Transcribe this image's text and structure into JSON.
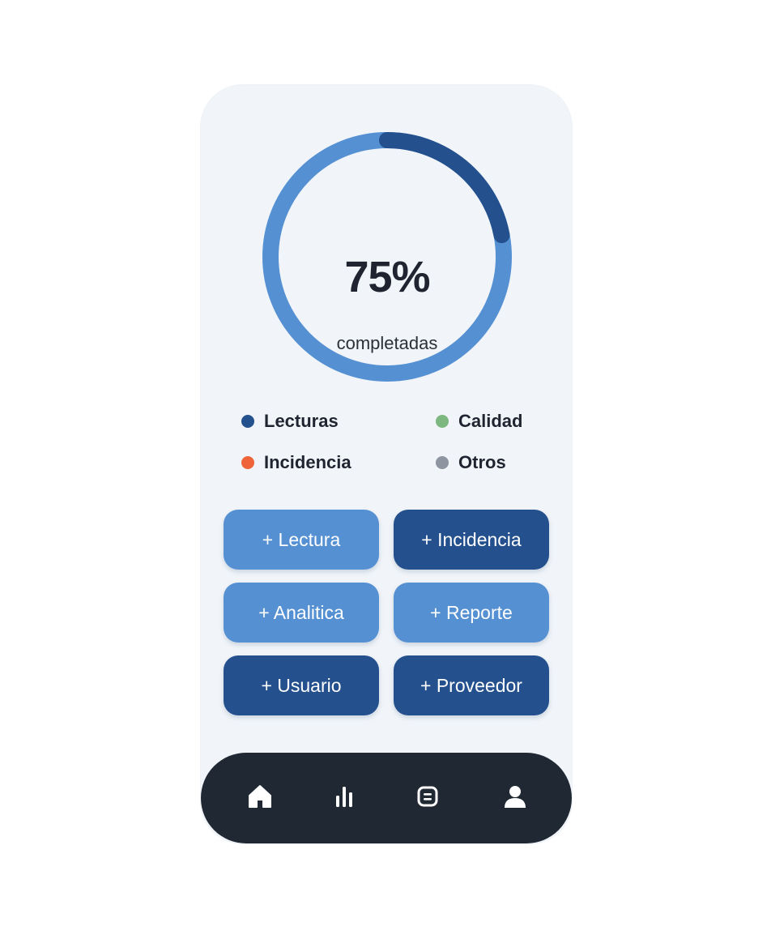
{
  "progress": {
    "percent_label": "75%",
    "caption": "completadas",
    "value": 0.75,
    "highlight_fraction": 0.22,
    "track_color": "#5590d3",
    "highlight_color": "#24508e"
  },
  "legend": [
    {
      "label": "Lecturas",
      "color": "#24508e"
    },
    {
      "label": "Calidad",
      "color": "#7bb77e"
    },
    {
      "label": "Incidencia",
      "color": "#f0643a"
    },
    {
      "label": "Otros",
      "color": "#8e95a0"
    }
  ],
  "actions": [
    {
      "label": "+ Lectura",
      "color": "#5590d3"
    },
    {
      "label": "+ Incidencia",
      "color": "#24508e"
    },
    {
      "label": "+ Analitica",
      "color": "#5590d3"
    },
    {
      "label": "+ Reporte",
      "color": "#5590d3"
    },
    {
      "label": "+ Usuario",
      "color": "#24508e"
    },
    {
      "label": "+ Proveedor",
      "color": "#24508e"
    }
  ],
  "tabbar": {
    "tabs": [
      {
        "icon": "home-icon"
      },
      {
        "icon": "bar-chart-icon"
      },
      {
        "icon": "document-icon"
      },
      {
        "icon": "user-icon"
      }
    ]
  }
}
